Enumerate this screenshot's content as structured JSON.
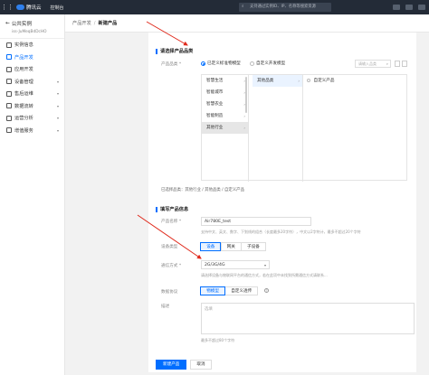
{
  "topbar": {
    "menu_icon": "grid-menu-icon",
    "brand": "腾讯云",
    "console": "控制台",
    "search_placeholder": "支持通过实例ID、IP、名称等搜索资源"
  },
  "sidebar": {
    "title": "公共实例",
    "subtitle": "iss-JuMeqBdDcHO",
    "items": [
      {
        "label": "实例信息",
        "icon": "info-icon"
      },
      {
        "label": "产品开发",
        "icon": "product-icon",
        "active": true
      },
      {
        "label": "应用开发",
        "icon": "app-icon"
      },
      {
        "label": "设备管理",
        "icon": "device-icon",
        "caret": true
      },
      {
        "label": "售后运维",
        "icon": "ops-icon",
        "caret": true
      },
      {
        "label": "数据流转",
        "icon": "flow-icon",
        "caret": true
      },
      {
        "label": "运营分析",
        "icon": "chart-icon",
        "caret": true
      },
      {
        "label": "增值服务",
        "icon": "service-icon",
        "caret": true
      }
    ]
  },
  "breadcrumb": {
    "parent": "产品开发",
    "separator": "/",
    "current": "新建产品"
  },
  "category_section": {
    "title": "请选择产品品类",
    "label": "产品品类 *",
    "radio_standard": "已定义标准物模型",
    "radio_custom": "自定义开发模型",
    "filter_placeholder": "请输入品类",
    "col1": [
      "智慧生活",
      "智能城市",
      "智慧农业",
      "智能制造",
      "其他行业"
    ],
    "col2": [
      "其他品类"
    ],
    "col3": [
      "自定义产品"
    ],
    "selected_text": "已选择品类：其他行业 / 其他品类 / 自定义产品"
  },
  "info_section": {
    "title": "填写产品信息",
    "name_label": "产品名称 *",
    "name_value": "Air780E_test",
    "name_hint": "支持中文、英文、数字、下划线的组合（长度最多20字符），中文以2字符计，最多不超过20个字符",
    "type_label": "设备类型",
    "type_options": [
      "设备",
      "网关",
      "子设备"
    ],
    "comm_label": "通信方式 *",
    "comm_value": "2G/3G/4G",
    "comm_hint": "请选择设备与物联网平台的通信方式，若在此项中未找到所需通信方式请联系...",
    "protocol_label": "数据协议",
    "protocol_options": [
      "物模型",
      "自定义透传"
    ],
    "desc_label": "描述",
    "desc_placeholder": "选填",
    "desc_hint": "最多不超过80个字符"
  },
  "footer": {
    "primary": "新建产品",
    "cancel": "取消"
  },
  "colors": {
    "accent": "#006eff",
    "topbar": "#232b37",
    "arrow": "#e0291b"
  }
}
